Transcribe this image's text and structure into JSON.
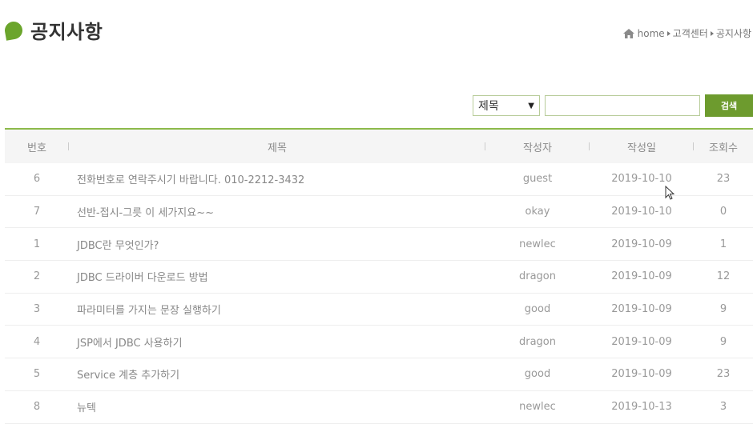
{
  "page": {
    "title": "공지사항"
  },
  "breadcrumb": {
    "items": [
      "home",
      "고객센터",
      "공지사항"
    ]
  },
  "search": {
    "field_selected": "제목",
    "query_value": "",
    "button_label": "검색"
  },
  "table": {
    "headers": [
      "번호",
      "제목",
      "작성자",
      "작성일",
      "조회수"
    ],
    "rows": [
      {
        "no": "6",
        "title": "전화번호로 연락주시기 바랍니다. 010-2212-3432",
        "writer": "guest",
        "date": "2019-10-10",
        "hit": "23"
      },
      {
        "no": "7",
        "title": "선반-접시-그릇 이 세가지요~~",
        "writer": "okay",
        "date": "2019-10-10",
        "hit": "0"
      },
      {
        "no": "1",
        "title": "JDBC란 무엇인가?",
        "writer": "newlec",
        "date": "2019-10-09",
        "hit": "1"
      },
      {
        "no": "2",
        "title": "JDBC 드라이버 다운로드 방법",
        "writer": "dragon",
        "date": "2019-10-09",
        "hit": "12"
      },
      {
        "no": "3",
        "title": "파라미터를 가지는 문장 실행하기",
        "writer": "good",
        "date": "2019-10-09",
        "hit": "9"
      },
      {
        "no": "4",
        "title": "JSP에서 JDBC 사용하기",
        "writer": "dragon",
        "date": "2019-10-09",
        "hit": "9"
      },
      {
        "no": "5",
        "title": "Service 계층 추가하기",
        "writer": "good",
        "date": "2019-10-09",
        "hit": "23"
      },
      {
        "no": "8",
        "title": "뉴텍",
        "writer": "newlec",
        "date": "2019-10-13",
        "hit": "3"
      }
    ]
  },
  "colors": {
    "accent": "#6d9b2e",
    "leaf": "#6ba52c",
    "table_top_border": "#8cba4a"
  },
  "icons": [
    "leaf-icon",
    "home-icon",
    "chevron-down-icon",
    "mouse-cursor-icon"
  ]
}
